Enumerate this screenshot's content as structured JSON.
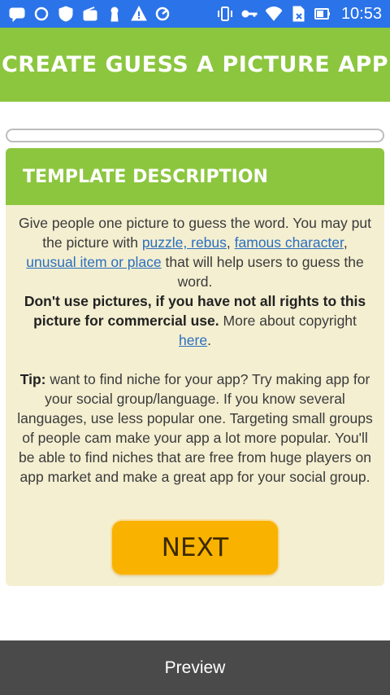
{
  "status_bar": {
    "time": "10:53",
    "icons": [
      "message-icon",
      "sync-icon",
      "shield-icon",
      "radio-icon",
      "keyhole-icon",
      "warning-icon",
      "download-speed-icon",
      "vibrate-icon",
      "key-icon",
      "wifi-icon",
      "no-sim-icon",
      "battery-icon"
    ]
  },
  "header": {
    "title": "CREATE GUESS A PICTURE APP"
  },
  "progress": {
    "percent": 0
  },
  "card": {
    "title": "TEMPLATE DESCRIPTION",
    "p1_text1": "Give people one picture to guess the word. You may put the picture with ",
    "link_puzzle": "puzzle, rebus",
    "p1_comma1": ", ",
    "link_famous": "famous character",
    "p1_comma2": ",",
    "link_unusual": "unusual item or place",
    "p1_text2": " that will help users to guess the word.",
    "warning_bold": "Don't use pictures, if you have not all rights to this picture for commercial use.",
    "copyright_text": " More about copyright ",
    "link_here": "here",
    "period": ".",
    "tip_label": "Tip:",
    "tip_text": " want to find niche for your app? Try making app for your social group/language. If you know several languages, use less popular one. Targeting small groups of people cam make your app a lot more popular. You'll be able to find niches that are free from huge players on app market and make a great app for your social group.",
    "next_label": "NEXT"
  },
  "preview": {
    "label": "Preview"
  },
  "colors": {
    "status_bar": "#2b73e8",
    "brand_green": "#8cc63f",
    "card_bg": "#f4efd1",
    "next_button": "#f9b200",
    "preview_bar": "#4a4a4a",
    "link": "#2a6fbf"
  }
}
